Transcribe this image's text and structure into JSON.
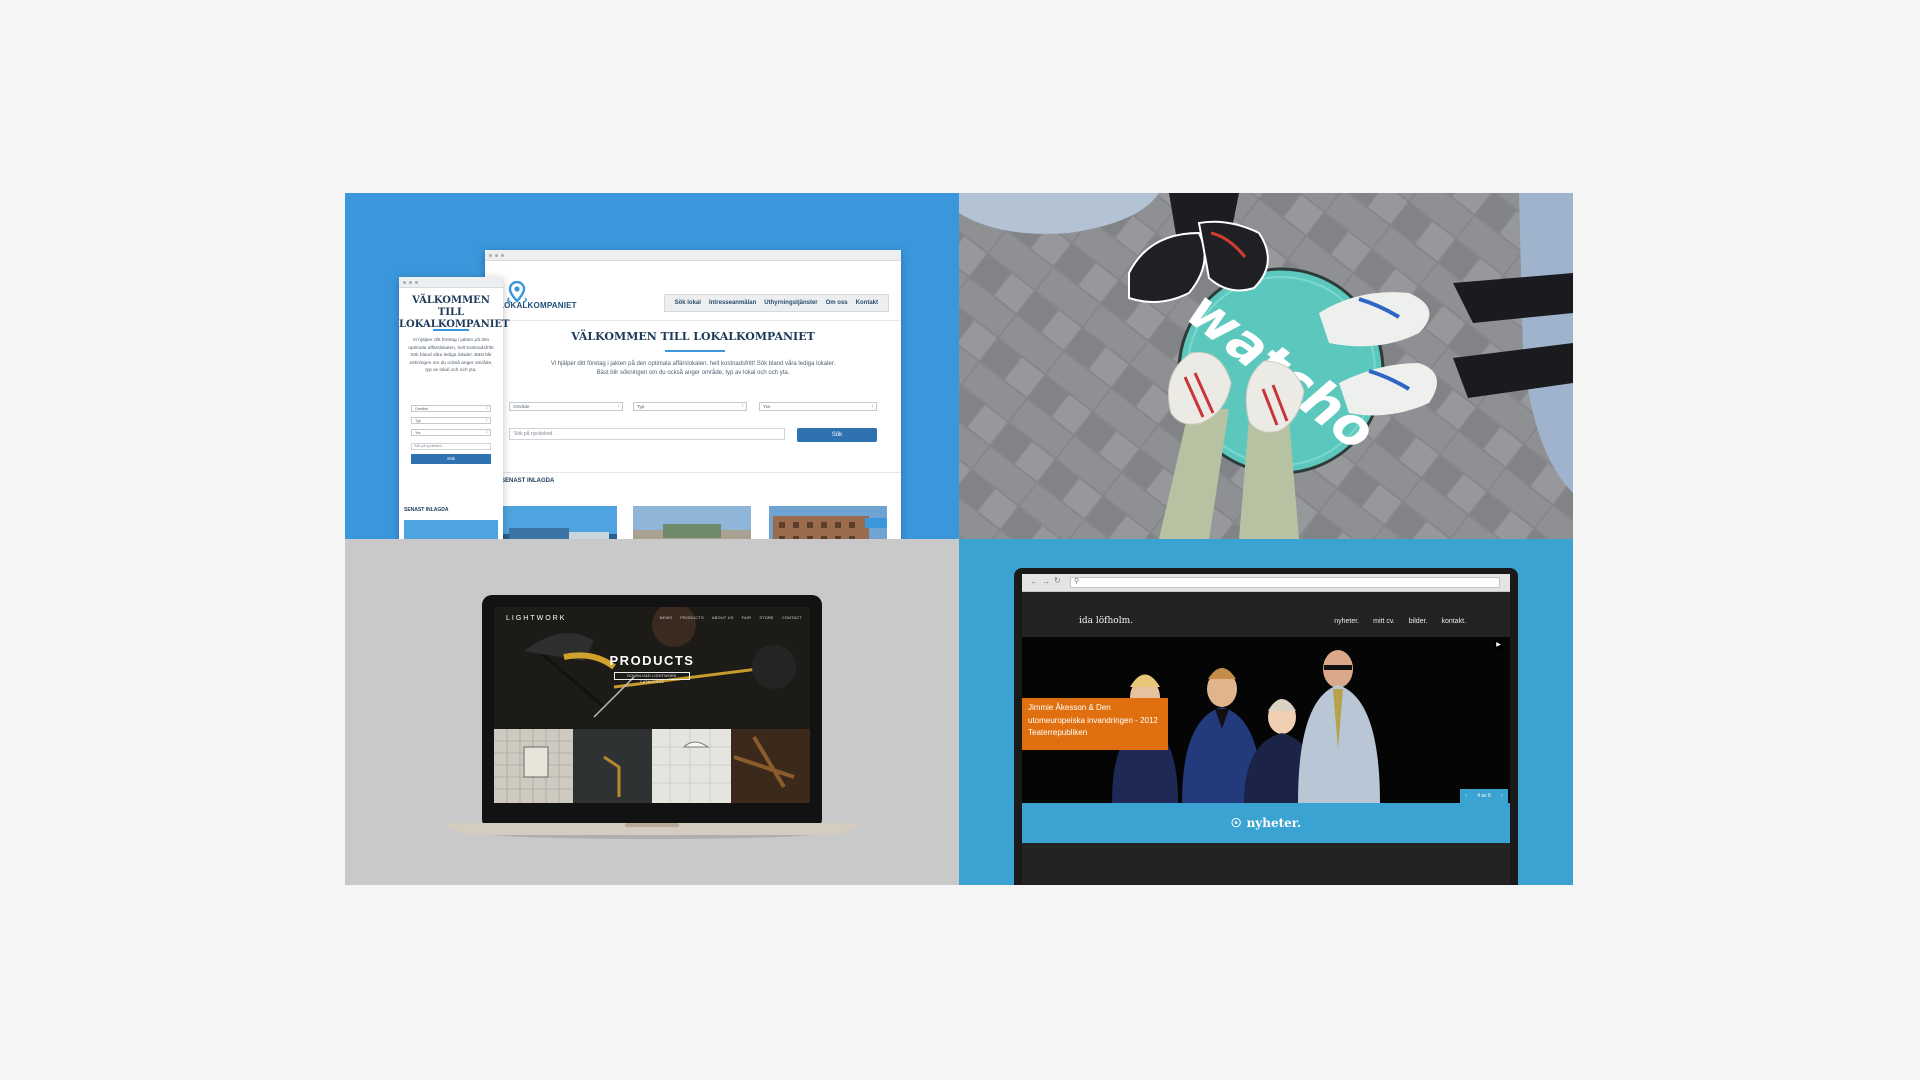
{
  "panel1": {
    "desktop": {
      "brand": "LOKALKOMPANIET",
      "nav": [
        "Sök lokal",
        "Intresseanmälan",
        "Uthyrningstjänster",
        "Om oss",
        "Kontakt"
      ],
      "title": "VÄLKOMMEN TILL LOKALKOMPANIET",
      "lead": "Vi hjälper ditt företag i jakten på den optimala affärslokalen, helt kostnadsfritt! Sök bland våra lediga lokaler. Bäst blir sökningen om du också anger område, typ av lokal och och yta.",
      "selects": [
        "Område",
        "Typ",
        "Yta"
      ],
      "search_placeholder": "Sök på nyckelord",
      "search_button": "Sök",
      "section": "SENAST INLAGDA"
    },
    "mobile": {
      "title": "VÄLKOMMEN TILL LOKALKOMPANIET",
      "lead": "Vi hjälper ditt företag i jakten på den optimala affärslokalen, helt kostnadsfritt! Sök bland våra lediga lokaler. Bäst blir sökningen om du också anger område, typ av lokal och och yta.",
      "selects": [
        "Område",
        "Typ",
        "Yta"
      ],
      "search_placeholder": "Sök på nyckelord",
      "search_button": "Sök",
      "section": "SENAST INLAGDA"
    },
    "colors": {
      "background": "#3a97dc",
      "accent": "#2e73b0"
    }
  },
  "panel2": {
    "sticker_text": "watcho",
    "colors": {
      "sticker": "#5cc8bd"
    }
  },
  "panel3": {
    "brand": "LIGHTWORK",
    "nav": [
      "NEWS",
      "PRODUCTS",
      "ABOUT US",
      "FAIR",
      "STORE",
      "CONTACT"
    ],
    "title": "PRODUCTS",
    "cta": "DOWNLOAD LIGHTWORK CATALOGUE"
  },
  "panel4": {
    "site_name": "ida löfholm.",
    "nav": [
      "nyheter.",
      "mitt cv.",
      "bilder.",
      "kontakt."
    ],
    "caption": "Jimmie Åkesson & Den utomeuropeiska invandringen - 2012 Teaterrepubliken",
    "pager": "4 av 6",
    "news_label": "nyheter.",
    "colors": {
      "accent": "#e0700f",
      "background": "#3aa3d1"
    }
  }
}
